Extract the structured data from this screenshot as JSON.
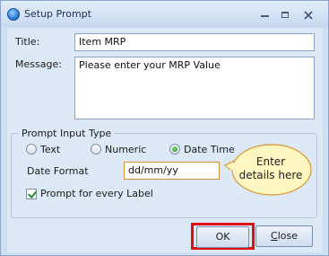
{
  "window": {
    "title": "Setup Prompt"
  },
  "form": {
    "title_label": "Title:",
    "title_value": "Item MRP",
    "message_label": "Message:",
    "message_value": "Please enter your MRP Value"
  },
  "prompt_input_type": {
    "group_label": "Prompt Input Type",
    "options": [
      {
        "label": "Text",
        "selected": false
      },
      {
        "label": "Numeric",
        "selected": false
      },
      {
        "label": "Date Time",
        "selected": true
      }
    ],
    "date_format_label": "Date Format",
    "date_format_value": "dd/mm/yy",
    "prompt_every_label": "Prompt for every Label",
    "prompt_every_checked": true
  },
  "callout": {
    "line1": "Enter",
    "line2": "details here"
  },
  "buttons": {
    "ok": "OK",
    "close_underlined": "C",
    "close_rest": "lose"
  },
  "colors": {
    "highlight": "#e01010",
    "callout_fill": "#fff7c2",
    "callout_border": "#d9962f"
  }
}
